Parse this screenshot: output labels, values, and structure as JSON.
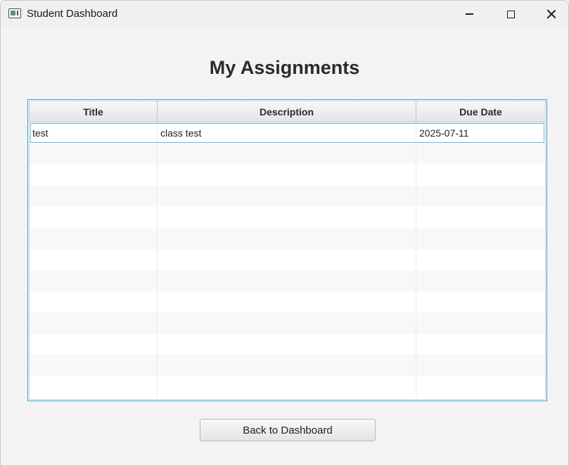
{
  "window": {
    "title": "Student Dashboard"
  },
  "page": {
    "heading": "My Assignments"
  },
  "table": {
    "columns": [
      "Title",
      "Description",
      "Due Date"
    ],
    "rows": [
      {
        "title": "test",
        "description": "class test",
        "due_date": "2025-07-11"
      }
    ],
    "selected_row": 0
  },
  "actions": {
    "back_label": "Back to Dashboard"
  },
  "colors": {
    "accent_border": "#2aa3d8",
    "window_bg": "#f3f3f3"
  }
}
